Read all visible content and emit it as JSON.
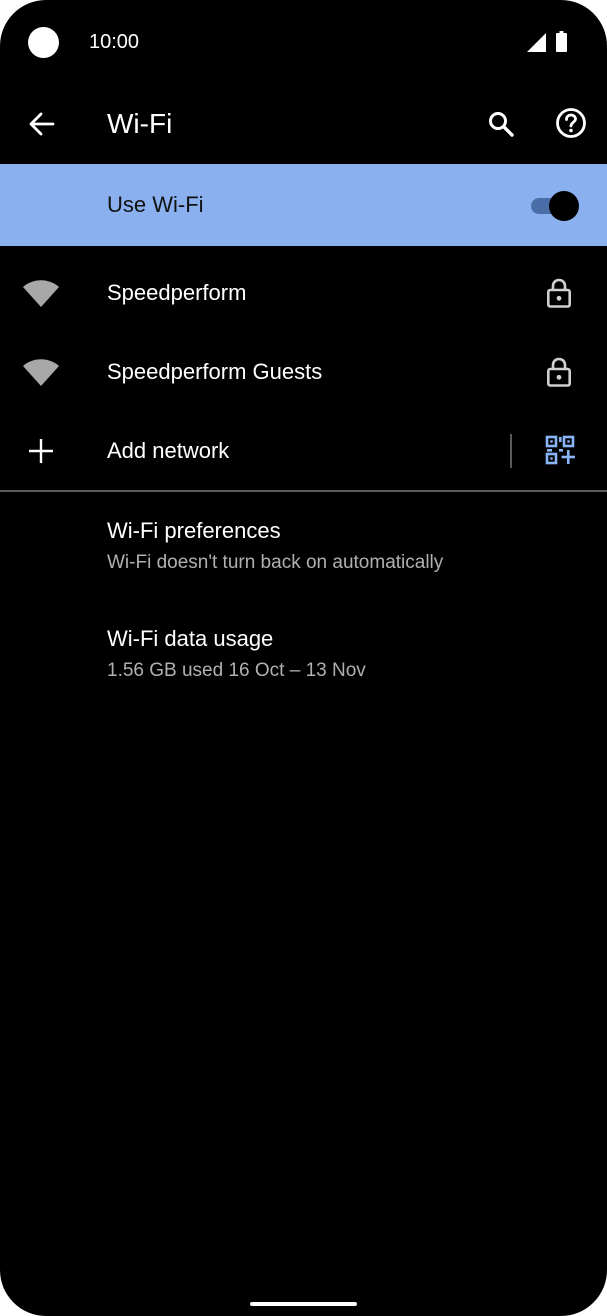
{
  "status_bar": {
    "time": "10:00",
    "icons": [
      "camera-cutout",
      "signal-icon",
      "battery-icon"
    ]
  },
  "app_bar": {
    "title": "Wi-Fi",
    "icons": [
      "back-arrow-icon",
      "search-icon",
      "help-icon"
    ]
  },
  "master_switch": {
    "label": "Use Wi-Fi",
    "enabled": true,
    "background_color": "#8ab0f0"
  },
  "networks": [
    {
      "name": "Speedperform",
      "secured": true,
      "icon": "wifi-signal-icon"
    },
    {
      "name": "Speedperform Guests",
      "secured": true,
      "icon": "wifi-signal-icon"
    }
  ],
  "add_network": {
    "label": "Add network",
    "icon": "plus-icon",
    "qr_icon": "qr-code-scan-icon",
    "accent_color": "#8ab4f8"
  },
  "preferences": {
    "title": "Wi-Fi preferences",
    "summary": "Wi-Fi doesn't turn back on automatically"
  },
  "data_usage": {
    "title": "Wi-Fi data usage",
    "summary": "1.56 GB used 16 Oct – 13 Nov"
  }
}
